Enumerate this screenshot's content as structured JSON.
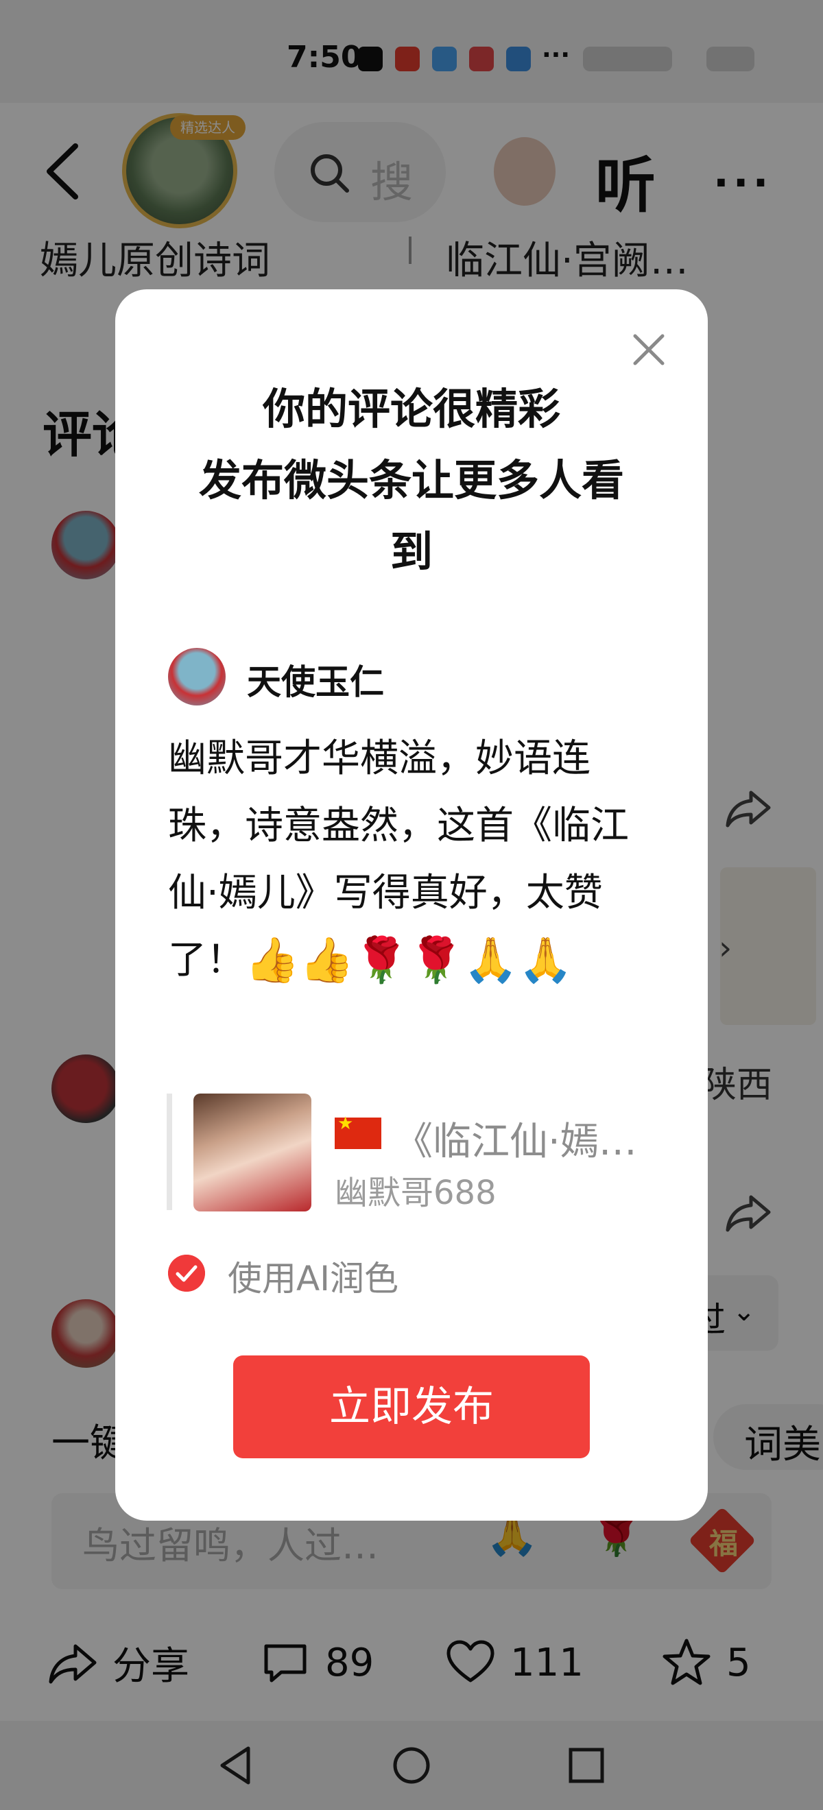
{
  "status_bar": {
    "time": "7:50"
  },
  "header": {
    "avatar_badge": "精选达人",
    "search_placeholder": "搜",
    "listen_label": "听",
    "more_label": "···",
    "subtitle_left": "嫣儿原创诗词",
    "subtitle_right": "临江仙·宫阙…"
  },
  "background": {
    "comments_heading": "评论",
    "side_text_1": "陕西",
    "side_chevron": "›",
    "pill_text": "过",
    "pill_chevron": "⌄",
    "yijian": "一键",
    "ci_pill": "词美"
  },
  "input_bar": {
    "placeholder": "鸟过留鸣，人过…",
    "emoji_1": "🙏",
    "emoji_2": "🌹",
    "fu_label": "福"
  },
  "bottom_actions": {
    "share_label": "分享",
    "comments_count": "89",
    "likes_count": "111",
    "favorites_count": "5"
  },
  "modal": {
    "title_lines": [
      "你的评论很精彩",
      "发布微头条让更多人看",
      "到"
    ],
    "author_name": "天使玉仁",
    "comment_text": "幽默哥才华横溢，妙语连珠，诗意盎然，这首《临江仙·嫣儿》写得真好，太赞了！",
    "comment_emojis": "👍👍🌹🌹🙏🙏",
    "quote_title": "《临江仙·嫣…",
    "quote_author": "幽默哥688",
    "ai_option_label": "使用AI润色",
    "ai_option_checked": true,
    "publish_label": "立即发布"
  },
  "colors": {
    "accent": "#f2403b",
    "overlay": "rgba(0,0,0,0.45)"
  }
}
